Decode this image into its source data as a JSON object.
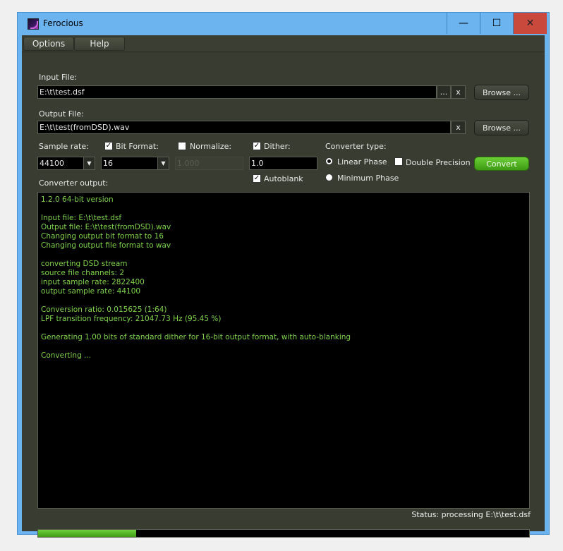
{
  "window": {
    "title": "Ferocious",
    "min_glyph": "—",
    "max_glyph": "☐",
    "close_glyph": "✕"
  },
  "menu": {
    "options": "Options",
    "help": "Help"
  },
  "input": {
    "label": "Input File:",
    "value": "E:\\t\\test.dsf",
    "ellipsis": "...",
    "clear": "x",
    "browse": "Browse ..."
  },
  "output": {
    "label": "Output File:",
    "value": "E:\\t\\test(fromDSD).wav",
    "clear": "x",
    "browse": "Browse ..."
  },
  "options": {
    "sample_rate_label": "Sample rate:",
    "sample_rate_value": "44100",
    "bit_format_label": "Bit Format:",
    "bit_format_checked": true,
    "bit_format_value": "16",
    "normalize_label": "Normalize:",
    "normalize_checked": false,
    "normalize_value": "1.000",
    "dither_label": "Dither:",
    "dither_checked": true,
    "dither_value": "1.0",
    "autoblank_label": "Autoblank",
    "autoblank_checked": true,
    "converter_type_label": "Converter type:",
    "linear_phase_label": "Linear Phase",
    "minimum_phase_label": "Minimum Phase",
    "selected_phase": "linear",
    "double_precision_label": "Double Precision",
    "double_precision_checked": false,
    "convert_label": "Convert",
    "check_glyph": "✓"
  },
  "converter_output": {
    "label": "Converter output:",
    "lines": [
      "1.2.0 64-bit version",
      "",
      "Input file: E:\\t\\test.dsf",
      "Output file: E:\\t\\test(fromDSD).wav",
      "Changing output bit format to 16",
      "Changing output file format to wav",
      "",
      "converting DSD stream",
      "source file channels: 2",
      "input sample rate: 2822400",
      "output sample rate: 44100",
      "",
      "Conversion ratio: 0.015625 (1:64)",
      "LPF transition frequency: 21047.73 Hz (95.45 %)",
      "",
      "Generating 1.00 bits of standard dither for 16-bit output format, with auto-blanking",
      "",
      "Converting ..."
    ]
  },
  "status": "Status: processing E:\\t\\test.dsf",
  "progress_percent": 20,
  "colors": {
    "console_text": "#7fd44a",
    "accent_green": "#4fae20",
    "titlebar": "#6cb4f0",
    "close": "#c94a3c",
    "panel": "#393d31"
  }
}
